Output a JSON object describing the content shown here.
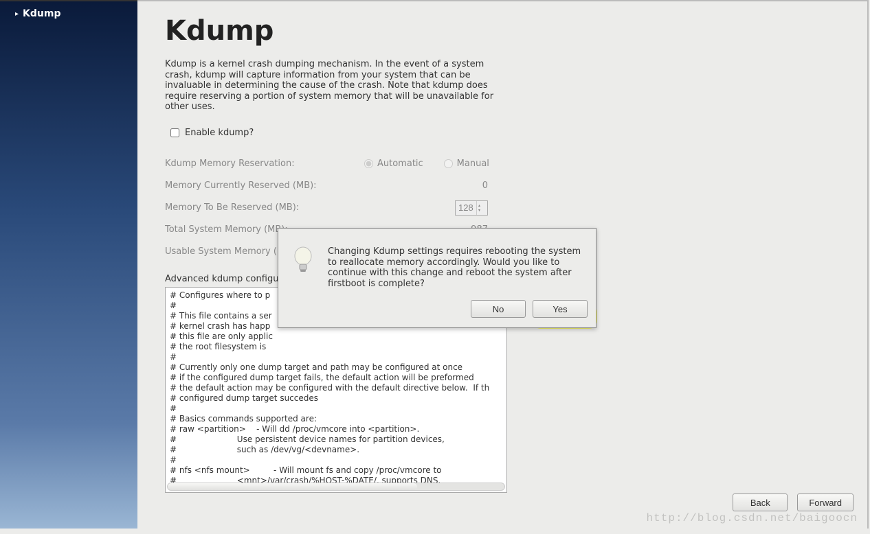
{
  "sidebar": {
    "items": [
      {
        "label": "Kdump"
      }
    ]
  },
  "page": {
    "title": "Kdump",
    "description": "Kdump is a kernel crash dumping mechanism. In the event of a system crash, kdump will capture information from your system that can be invaluable in determining the cause of the crash. Note that kdump does require reserving a portion of system memory that will be unavailable for other uses."
  },
  "enable": {
    "label": "Enable kdump?",
    "checked": false
  },
  "memory": {
    "reservation_label": "Kdump Memory Reservation:",
    "automatic_label": "Automatic",
    "manual_label": "Manual",
    "selected": "automatic",
    "current_label": "Memory Currently Reserved (MB):",
    "current_value": "0",
    "to_reserve_label": "Memory To Be Reserved (MB):",
    "to_reserve_value": "128",
    "total_label": "Total System Memory (MB):",
    "total_value": "987",
    "usable_label": "Usable System Memory ("
  },
  "advanced": {
    "label": "Advanced kdump configu",
    "config_text": "# Configures where to p\n#\n# This file contains a ser\n# kernel crash has happ\n# this file are only applic\n# the root filesystem is \n#\n# Currently only one dump target and path may be configured at once\n# if the configured dump target fails, the default action will be preformed\n# the default action may be configured with the default directive below.  If th\n# configured dump target succedes\n#\n# Basics commands supported are:\n# raw <partition>    - Will dd /proc/vmcore into <partition>.\n#                       Use persistent device names for partition devices,\n#                       such as /dev/vg/<devname>.\n#\n# nfs <nfs mount>         - Will mount fs and copy /proc/vmcore to\n#                       <mnt>/var/crash/%HOST-%DATE/, supports DNS."
  },
  "dialog": {
    "message": "Changing Kdump settings requires rebooting the system to reallocate memory accordingly. Would you like to continue with this change and reboot the system after firstboot is complete?",
    "no_label": "No",
    "yes_label": "Yes"
  },
  "footer": {
    "back_label": "Back",
    "forward_label": "Forward"
  },
  "watermark": "http://blog.csdn.net/baigoocn"
}
